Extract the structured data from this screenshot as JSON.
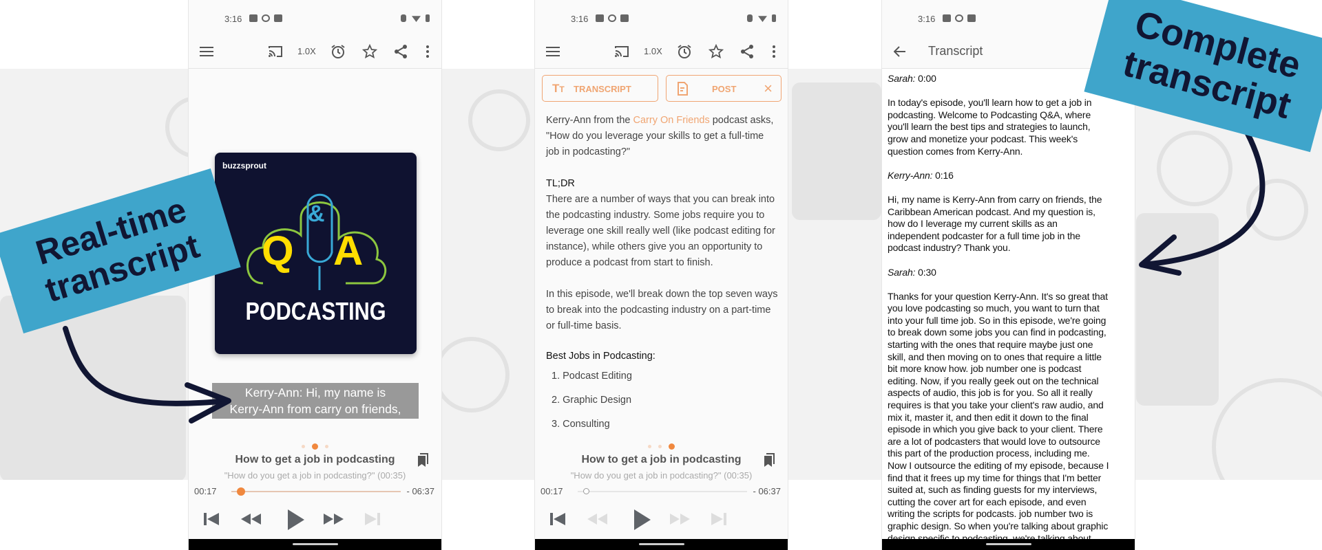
{
  "colors": {
    "accent": "#f0883e",
    "label_bg": "#3fa5cb",
    "label_text": "#111633",
    "artwork_bg": "#0f1230"
  },
  "annotations": {
    "left": {
      "line1": "Real-time",
      "line2": "transcript"
    },
    "right": {
      "line1": "Complete",
      "line2": "transcript"
    }
  },
  "status_bar": {
    "time": "3:16",
    "icons": [
      "gmail-icon",
      "pinwheel-icon",
      "youtube-icon",
      "vibrate-icon",
      "wifi-icon",
      "battery-icon"
    ]
  },
  "player": {
    "toolbar": {
      "icons": [
        "menu-icon",
        "cast-icon",
        "alarm-icon",
        "star-icon",
        "share-icon",
        "more-icon"
      ],
      "speed": "1.0X"
    },
    "artwork": {
      "brand": "buzzsprout",
      "amp": "&",
      "q": "Q",
      "a": "A",
      "word": "PODCASTING"
    },
    "caption_line1": "Kerry-Ann: Hi, my name is",
    "caption_line2": "Kerry-Ann from carry on friends,",
    "episode_title": "How to get a job in podcasting",
    "chapter": "\"How do you get a job in podcasting?\" (00:35)",
    "elapsed": "00:17",
    "remaining": "- 06:37",
    "progress_fraction": 0.04,
    "page_indicator": {
      "pages": 3,
      "active": 2
    }
  },
  "notes": {
    "chips": {
      "transcript": "TRANSCRIPT",
      "post": "POST"
    },
    "intro_prefix": "Kerry-Ann from the ",
    "intro_link": "Carry On Friends",
    "intro_suffix": " podcast asks,",
    "intro_lines": [
      "\"How do you leverage your skills to get a full-time",
      "job in podcasting?\""
    ],
    "tldr_heading": "TL;DR",
    "tldr_lines": [
      "There are a number of ways that you can break into",
      "the podcasting industry. Some jobs require you to",
      "leverage one skill really well (like podcast editing for",
      "instance), while others give you an opportunity to",
      "produce a podcast from start to finish."
    ],
    "episode_lines": [
      "In this episode, we'll break down the top seven ways",
      "to break into the podcasting industry on a part-time",
      "or full-time basis."
    ],
    "jobs_heading": "Best Jobs in Podcasting:",
    "jobs": [
      "1. Podcast Editing",
      "2. Graphic Design",
      "3. Consulting"
    ],
    "page_indicator": {
      "pages": 3,
      "active": 3
    }
  },
  "transcript": {
    "title": "Transcript",
    "blocks": [
      {
        "speaker": "Sarah:",
        "time": " 0:00",
        "lines": [
          "In today's episode, you'll learn how to get a job in",
          "podcasting. Welcome to Podcasting Q&A, where",
          "you'll learn the best tips and strategies to launch,",
          "grow and monetize your podcast. This week's",
          "question comes from Kerry-Ann."
        ]
      },
      {
        "speaker": "Kerry-Ann:",
        "time": " 0:16",
        "lines": [
          "Hi, my name is Kerry-Ann from carry on friends, the",
          "Caribbean American podcast. And my question is,",
          "how do I leverage my current skills as an",
          "independent podcaster for a full time job in the",
          "podcast industry? Thank you."
        ]
      },
      {
        "speaker": "Sarah:",
        "time": " 0:30",
        "lines": [
          "Thanks for your question Kerry-Ann. It's so great that",
          "you love podcasting so much, you want to turn that",
          "into your full time job. So in this episode, we're going",
          "to break down some jobs you can find in podcasting,",
          "starting with the ones that require maybe just one",
          "skill, and then moving on to ones that require a little",
          "bit more know how. job number one is podcast",
          "editing. Now, if you really geek out on the technical",
          "aspects of audio, this job is for you. So all it really",
          "requires is that you take your client's raw audio, and",
          "mix it, master it, and then edit it down to the final",
          "episode in which you give back to your client. There",
          "are a lot of podcasters that would love to outsource",
          "this part of the production process, including me.",
          "Now I outsource the editing of my episode, because I",
          "find that it frees up my time for things that I'm better",
          "suited at, such as finding guests for my interviews,",
          "cutting the cover art for each episode, and even",
          "writing the scripts for podcasts. job number two is",
          "graphic design. So when you're talking about graphic",
          "design specific to podcasting, we're talking about"
        ]
      }
    ]
  }
}
